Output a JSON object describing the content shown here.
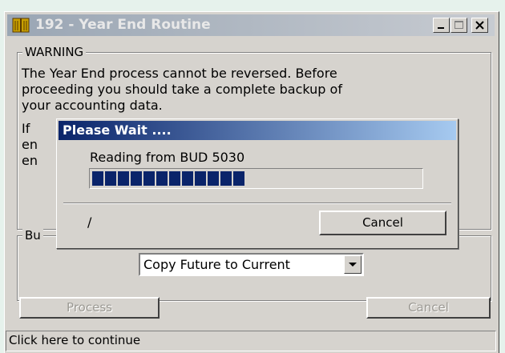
{
  "window": {
    "title": "192 - Year End Routine",
    "icon": "ledger-book-icon"
  },
  "warning": {
    "label": "WARNING",
    "lines": [
      "The Year End process cannot be reversed. Before",
      "proceeding you should take a complete backup of",
      "your accounting data."
    ],
    "partial_lines": [
      "If",
      "en",
      "en"
    ]
  },
  "budget": {
    "label": "Bu",
    "selected": "Copy Future to Current"
  },
  "buttons": {
    "process": "Process",
    "cancel": "Cancel"
  },
  "status_bar": "Click here to continue",
  "progress_dialog": {
    "title": "Please Wait ....",
    "message": "Reading from BUD 5030",
    "progress_blocks_filled": 12,
    "progress_fraction": 0.46,
    "spinner_char": "/",
    "cancel_label": "Cancel"
  }
}
